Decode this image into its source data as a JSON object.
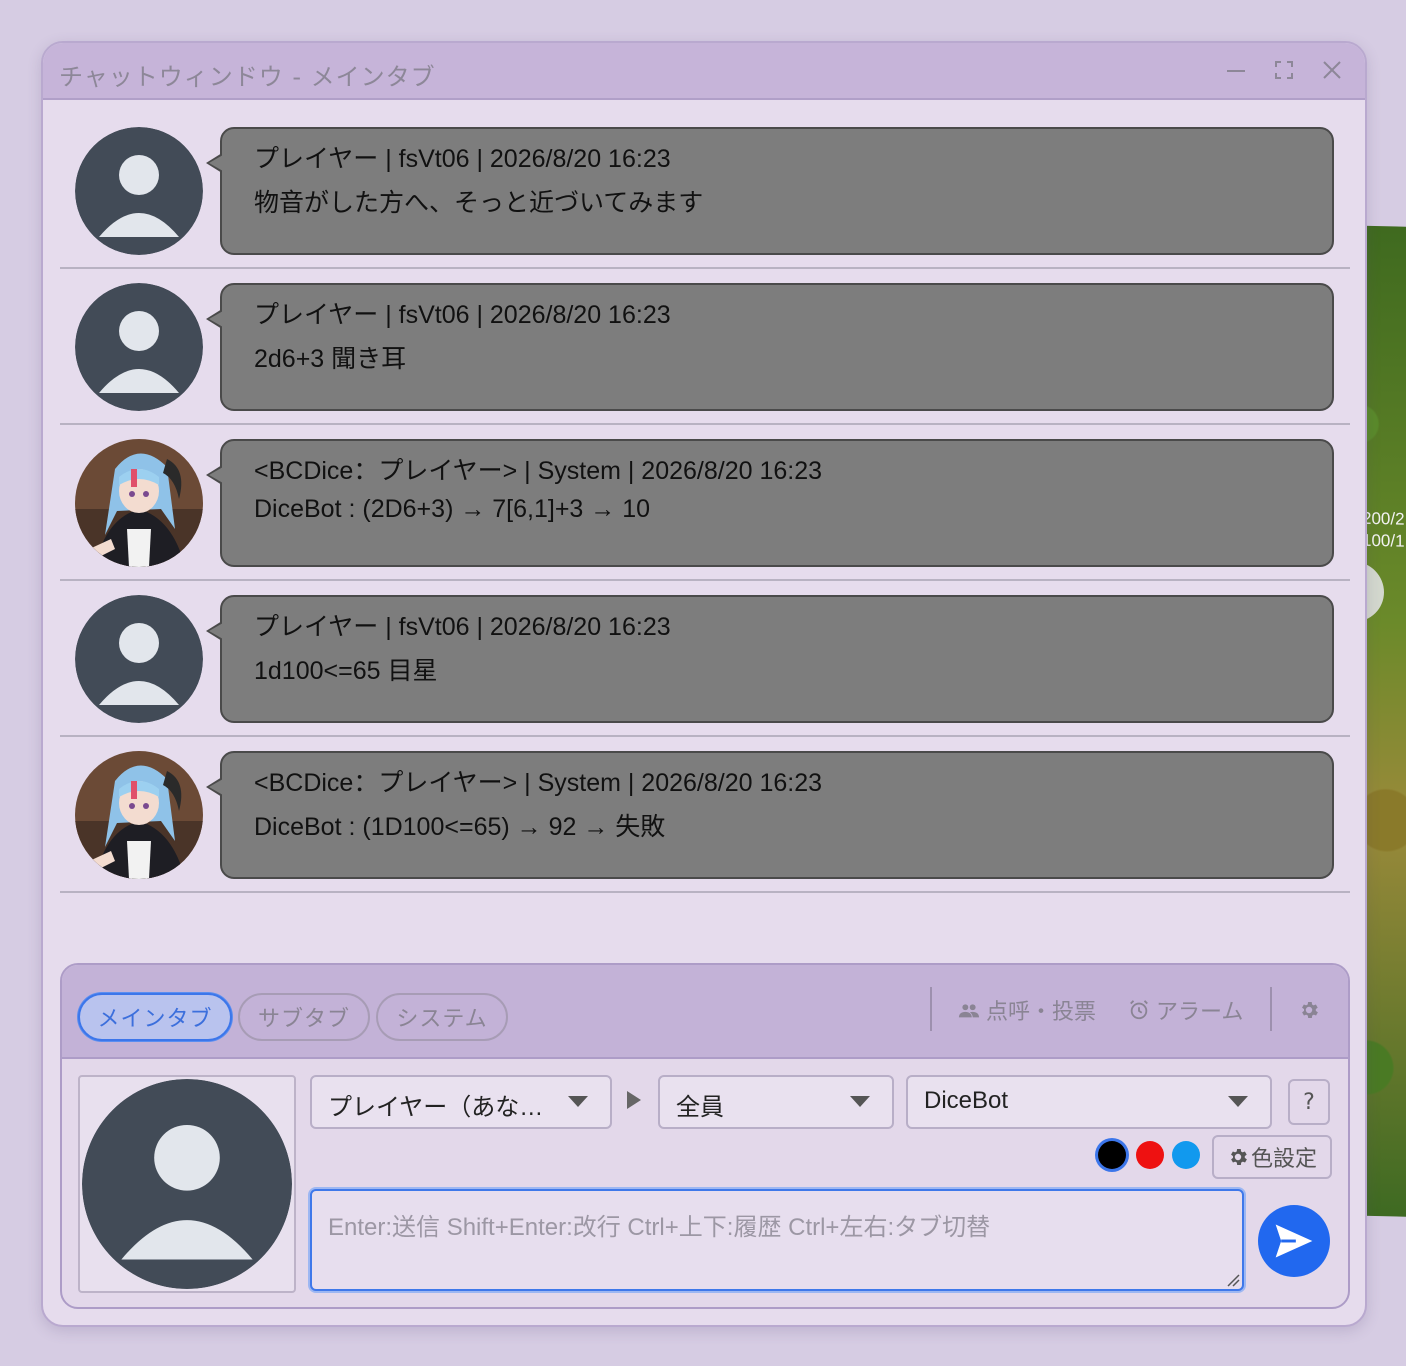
{
  "window": {
    "title": "チャットウィンドウ - メインタブ",
    "controls": [
      "minimize-icon",
      "maximize-icon",
      "close-icon"
    ]
  },
  "background": {
    "coord_line_1": "200/2",
    "coord_line_2": "100/1"
  },
  "messages": [
    {
      "avatar": "default-user-icon",
      "meta": "プレイヤー | fsVt06 | 2026/8/20 16:23",
      "text": "物音がした方へ、そっと近づいてみます"
    },
    {
      "avatar": "default-user-icon",
      "meta": "プレイヤー | fsVt06 | 2026/8/20 16:23",
      "text": "2d6+3 聞き耳"
    },
    {
      "avatar": "character-portrait",
      "meta": "<BCDice：プレイヤー> | System | 2026/8/20 16:23",
      "text": "DiceBot : (2D6+3) → 7[6,1]+3 → 10"
    },
    {
      "avatar": "default-user-icon",
      "meta": "プレイヤー | fsVt06 | 2026/8/20 16:23",
      "text": "1d100<=65 目星"
    },
    {
      "avatar": "character-portrait",
      "meta": "<BCDice：プレイヤー> | System | 2026/8/20 16:23",
      "text": "DiceBot : (1D100<=65) → 92 → 失敗"
    }
  ],
  "tabs": [
    {
      "label": "メインタブ",
      "active": true
    },
    {
      "label": "サブタブ",
      "active": false
    },
    {
      "label": "システム",
      "active": false
    }
  ],
  "toolbar": {
    "rollcall_label": "点呼・投票",
    "alarm_label": "アラーム",
    "settings_icon": "gear-icon"
  },
  "input": {
    "character_select": "プレイヤー（あな…",
    "target_select": "全員",
    "system_select": "DiceBot",
    "help_label": "?",
    "colors": [
      "#000000",
      "#ee1111",
      "#1199ee"
    ],
    "color_settings_label": "色設定",
    "placeholder": "Enter:送信 Shift+Enter:改行 Ctrl+上下:履歴 Ctrl+左右:タブ切替",
    "accent": "#2168ef"
  }
}
